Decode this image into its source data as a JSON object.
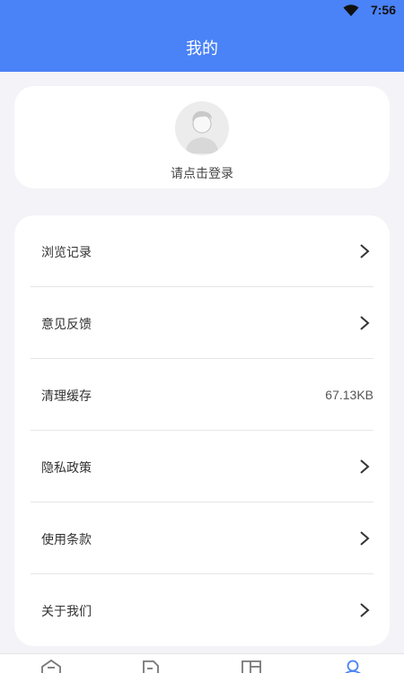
{
  "status_bar": {
    "time": "7:56"
  },
  "header": {
    "title": "我的"
  },
  "login": {
    "prompt": "请点击登录"
  },
  "menu": {
    "items": [
      {
        "label": "浏览记录"
      },
      {
        "label": "意见反馈"
      },
      {
        "label": "清理缓存",
        "value": "67.13KB"
      },
      {
        "label": "隐私政策"
      },
      {
        "label": "使用条款"
      },
      {
        "label": "关于我们"
      }
    ]
  },
  "tabbar": {
    "tabs": [
      {
        "icon": "home-icon"
      },
      {
        "icon": "document-icon"
      },
      {
        "icon": "layout-icon"
      },
      {
        "icon": "user-icon",
        "active": true
      }
    ]
  },
  "colors": {
    "accent": "#4a82f7",
    "background": "#f3f3f8",
    "card": "#ffffff"
  }
}
